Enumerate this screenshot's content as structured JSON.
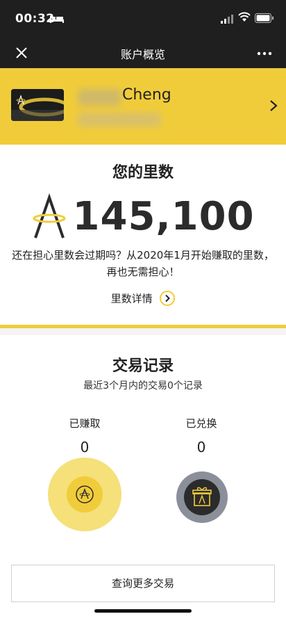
{
  "status_bar": {
    "time": "00:32"
  },
  "nav": {
    "title": "账户概览",
    "close_icon": "close-icon",
    "more_icon": "more-dots-icon"
  },
  "account": {
    "name_visible": "Cheng",
    "card_icon": "member-card-icon"
  },
  "miles": {
    "title": "您的里数",
    "value": "145,100",
    "promo": "还在担心里数会过期吗？从2020年1月开始赚取的里数，再也无需担心！",
    "details_label": "里数详情"
  },
  "transactions": {
    "title": "交易记录",
    "subtitle": "最近3个月内的交易0个记录",
    "earned_label": "已赚取",
    "earned_value": "0",
    "redeemed_label": "已兑换",
    "redeemed_value": "0",
    "query_button": "查询更多交易"
  },
  "colors": {
    "brand_yellow": "#f1cc3a",
    "dark": "#1f1f1f"
  }
}
